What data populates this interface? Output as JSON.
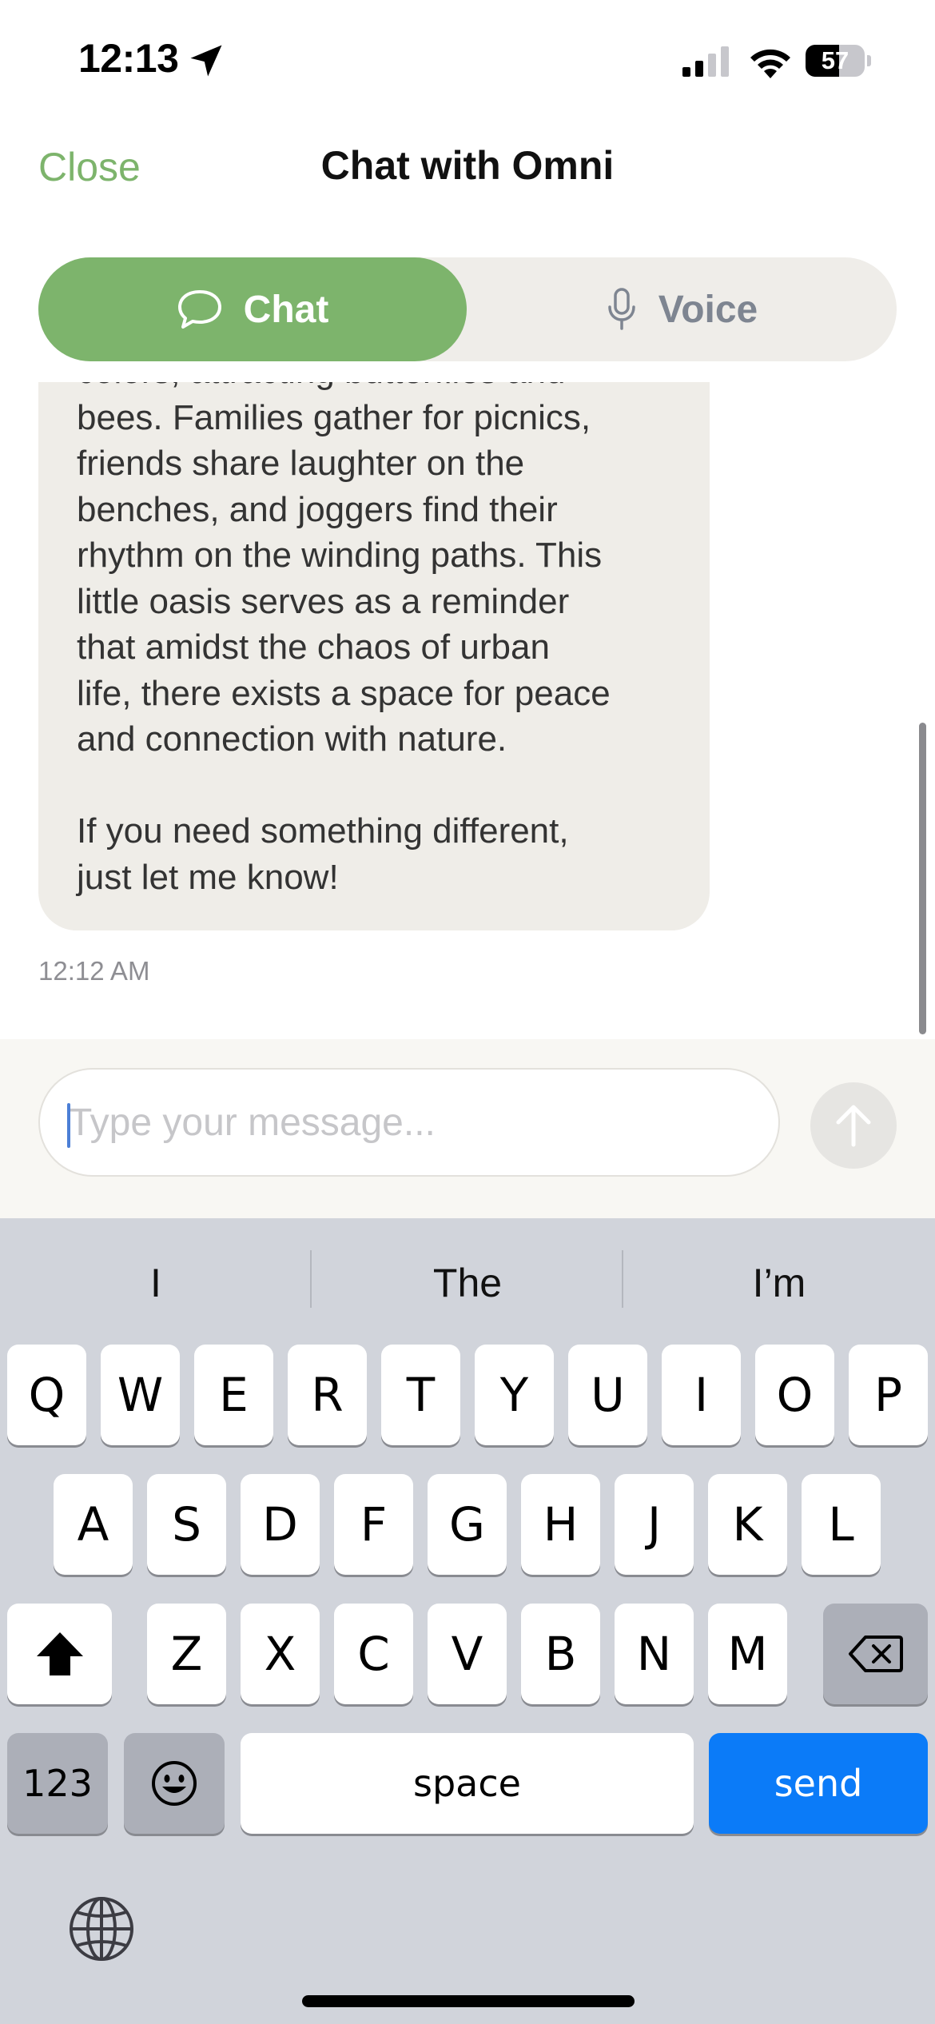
{
  "status_bar": {
    "time": "12:13",
    "battery_level": "57",
    "location_icon": "location-arrow-icon",
    "signal_icon": "cellular-signal-icon",
    "wifi_icon": "wifi-icon"
  },
  "header": {
    "close_label": "Close",
    "title": "Chat with Omni"
  },
  "mode_tabs": [
    {
      "label": "Chat",
      "icon": "speech-bubble-icon",
      "selected": true
    },
    {
      "label": "Voice",
      "icon": "microphone-icon",
      "selected": false
    }
  ],
  "messages": [
    {
      "sender": "assistant",
      "text": "colors, attracting butterflies and\nbees. Families gather for picnics,\nfriends share laughter on the\nbenches, and joggers find their\nrhythm on the winding paths. This\nlittle oasis serves as a reminder\nthat amidst the chaos of urban\nlife, there exists a space for peace\nand connection with nature.\n\nIf you need something different,\njust let me know!",
      "time": "12:12 AM"
    }
  ],
  "composer": {
    "placeholder": "Type your message...",
    "value": "",
    "send_icon": "arrow-up-icon"
  },
  "keyboard": {
    "suggestions": [
      "I",
      "The",
      "I’m"
    ],
    "row1": [
      "Q",
      "W",
      "E",
      "R",
      "T",
      "Y",
      "U",
      "I",
      "O",
      "P"
    ],
    "row2": [
      "A",
      "S",
      "D",
      "F",
      "G",
      "H",
      "J",
      "K",
      "L"
    ],
    "row3": [
      "Z",
      "X",
      "C",
      "V",
      "B",
      "N",
      "M"
    ],
    "numbers_label": "123",
    "space_label": "space",
    "send_label": "send"
  },
  "colors": {
    "accent": "#7db46c",
    "bubble": "#efede8",
    "keyboard_send": "#0b7bf8"
  }
}
